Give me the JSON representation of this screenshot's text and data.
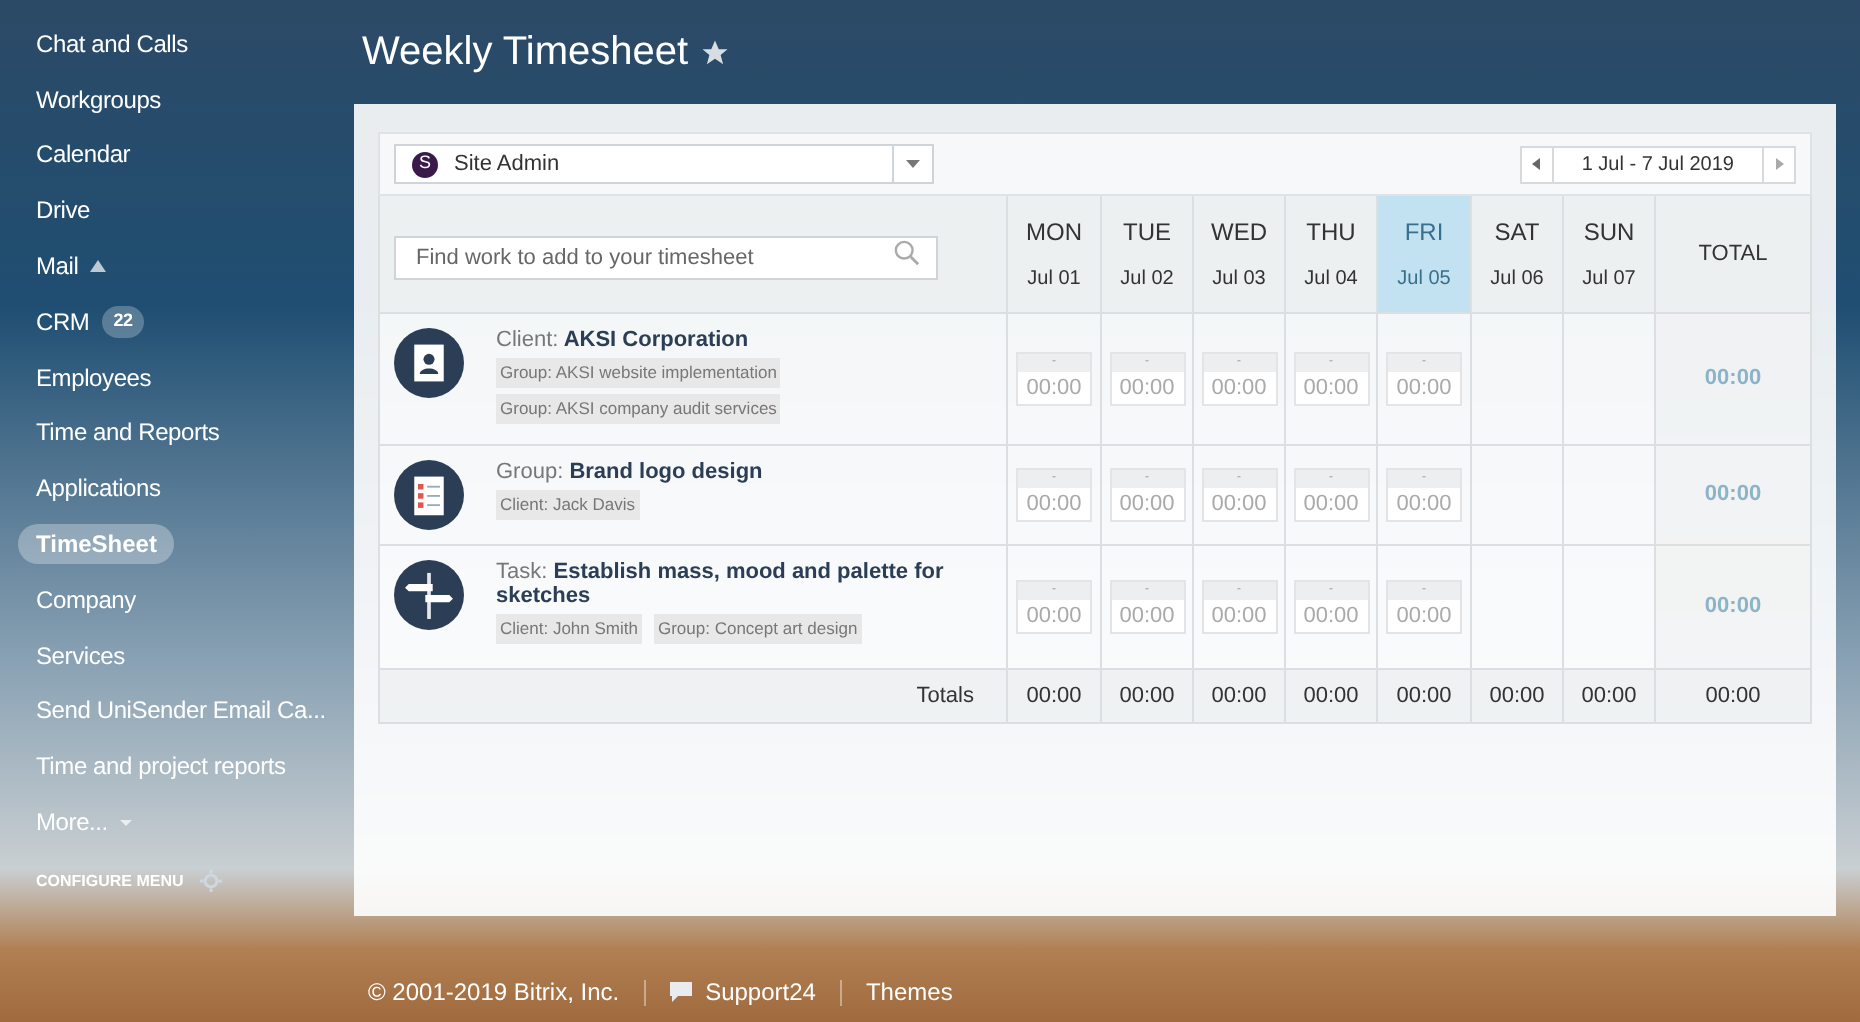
{
  "sidebar": {
    "items": [
      {
        "label": "Chat and Calls",
        "selected": false
      },
      {
        "label": "Workgroups",
        "selected": false
      },
      {
        "label": "Calendar",
        "selected": false
      },
      {
        "label": "Drive",
        "selected": false
      },
      {
        "label": "Mail",
        "selected": false
      },
      {
        "label": "CRM",
        "selected": false,
        "badge": "22"
      },
      {
        "label": "Employees",
        "selected": false
      },
      {
        "label": "Time and Reports",
        "selected": false
      },
      {
        "label": "Applications",
        "selected": false
      },
      {
        "label": "TimeSheet",
        "selected": true
      },
      {
        "label": "Company",
        "selected": false
      },
      {
        "label": "Services",
        "selected": false
      },
      {
        "label": "Send UniSender Email Ca...",
        "selected": false
      },
      {
        "label": "Time and project reports",
        "selected": false
      },
      {
        "label": "More...",
        "selected": false
      }
    ],
    "configure": "CONFIGURE MENU"
  },
  "page_title": "Weekly Timesheet",
  "user_select": {
    "avatar": "S",
    "value": "Site Admin"
  },
  "date_range": "1 Jul - 7 Jul 2019",
  "search": {
    "placeholder": "Find work to add to your timesheet"
  },
  "days": [
    {
      "day": "MON",
      "date": "Jul 01",
      "selected": false
    },
    {
      "day": "TUE",
      "date": "Jul 02",
      "selected": false
    },
    {
      "day": "WED",
      "date": "Jul 03",
      "selected": false
    },
    {
      "day": "THU",
      "date": "Jul 04",
      "selected": false
    },
    {
      "day": "FRI",
      "date": "Jul 05",
      "selected": true
    },
    {
      "day": "SAT",
      "date": "Jul 06",
      "selected": false
    },
    {
      "day": "SUN",
      "date": "Jul 07",
      "selected": false
    }
  ],
  "total_header": "TOTAL",
  "rows": [
    {
      "kind": "client",
      "prefix": "Client:",
      "name": "AKSI Corporation",
      "tags": [
        "Group: AKSI website implementation",
        "Group: AKSI company audit services"
      ],
      "cells": [
        {
          "kind": "entry",
          "label": "-",
          "value": "00:00"
        },
        {
          "kind": "entry",
          "label": "-",
          "value": "00:00"
        },
        {
          "kind": "entry",
          "label": "-",
          "value": "00:00"
        },
        {
          "kind": "entry",
          "label": "-",
          "value": "00:00"
        },
        {
          "kind": "entry",
          "label": "-",
          "value": "00:00"
        },
        {
          "kind": "blank"
        },
        {
          "kind": "blank"
        }
      ],
      "total": "00:00"
    },
    {
      "kind": "group",
      "prefix": "Group:",
      "name": "Brand logo design",
      "tags": [
        "Client: Jack Davis"
      ],
      "cells": [
        {
          "kind": "entry",
          "label": "-",
          "value": "00:00"
        },
        {
          "kind": "entry",
          "label": "-",
          "value": "00:00"
        },
        {
          "kind": "entry",
          "label": "-",
          "value": "00:00"
        },
        {
          "kind": "entry",
          "label": "-",
          "value": "00:00"
        },
        {
          "kind": "entry",
          "label": "-",
          "value": "00:00"
        },
        {
          "kind": "blank"
        },
        {
          "kind": "blank"
        }
      ],
      "total": "00:00"
    },
    {
      "kind": "task",
      "prefix": "Task:",
      "name": "Establish mass, mood and palette for sketches",
      "tags": [
        "Client: John Smith",
        "Group: Concept art design"
      ],
      "cells": [
        {
          "kind": "entry",
          "label": "-",
          "value": "00:00"
        },
        {
          "kind": "entry",
          "label": "-",
          "value": "00:00"
        },
        {
          "kind": "entry",
          "label": "-",
          "value": "00:00"
        },
        {
          "kind": "entry",
          "label": "-",
          "value": "00:00"
        },
        {
          "kind": "entry",
          "label": "-",
          "value": "00:00"
        },
        {
          "kind": "blank"
        },
        {
          "kind": "blank"
        }
      ],
      "total": "00:00"
    }
  ],
  "totals": {
    "label": "Totals",
    "values": [
      "00:00",
      "00:00",
      "00:00",
      "00:00",
      "00:00",
      "00:00",
      "00:00"
    ],
    "total": "00:00"
  },
  "footer": {
    "copyright": "© 2001-2019 Bitrix, Inc.",
    "links": [
      "Support24",
      "Themes"
    ]
  }
}
